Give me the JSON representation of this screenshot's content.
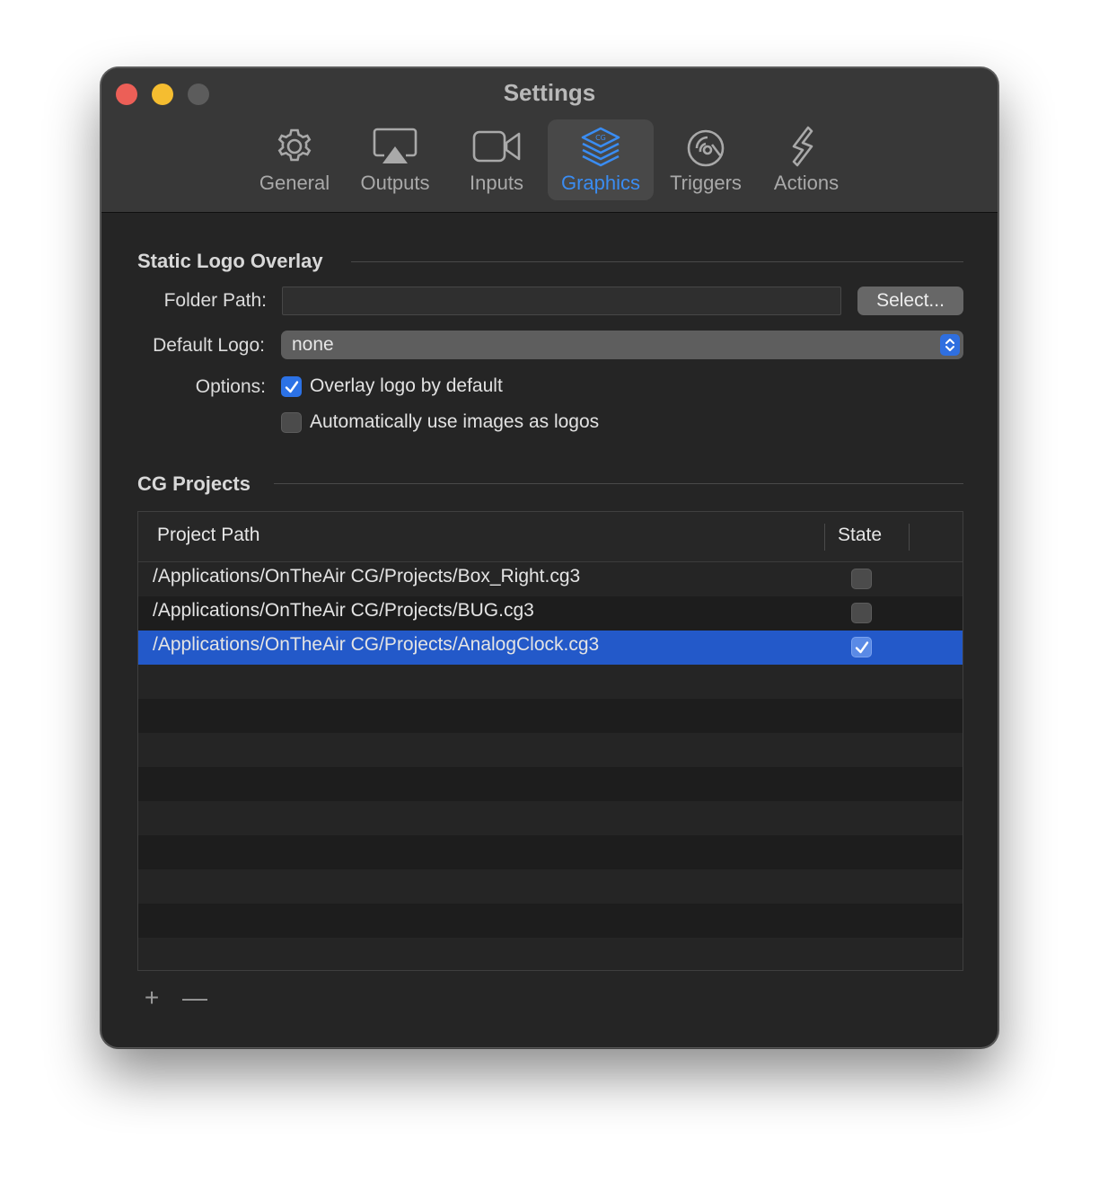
{
  "window": {
    "title": "Settings"
  },
  "tabs": [
    {
      "label": "General",
      "icon": "gear-icon"
    },
    {
      "label": "Outputs",
      "icon": "airplay-icon"
    },
    {
      "label": "Inputs",
      "icon": "video-camera-icon"
    },
    {
      "label": "Graphics",
      "icon": "cg-layers-icon",
      "active": true
    },
    {
      "label": "Triggers",
      "icon": "trigger-icon"
    },
    {
      "label": "Actions",
      "icon": "actions-icon"
    }
  ],
  "static_logo": {
    "section_title": "Static Logo Overlay",
    "folder_path_label": "Folder Path:",
    "folder_path_value": "",
    "select_button": "Select...",
    "default_logo_label": "Default Logo:",
    "default_logo_value": "none",
    "options_label": "Options:",
    "options": [
      {
        "label": "Overlay logo by default",
        "checked": true
      },
      {
        "label": "Automatically use images as logos",
        "checked": false
      }
    ]
  },
  "cg_projects": {
    "section_title": "CG Projects",
    "columns": [
      "Project Path",
      "State"
    ],
    "rows": [
      {
        "path": "/Applications/OnTheAir CG/Projects/Box_Right.cg3",
        "state": false,
        "selected": false
      },
      {
        "path": "/Applications/OnTheAir CG/Projects/BUG.cg3",
        "state": false,
        "selected": false
      },
      {
        "path": "/Applications/OnTheAir CG/Projects/AnalogClock.cg3",
        "state": true,
        "selected": true
      }
    ],
    "add_button": "+",
    "remove_button": "—"
  },
  "colors": {
    "accent": "#3a8cf2",
    "selection": "#2359c9",
    "window_bg": "#252525"
  }
}
